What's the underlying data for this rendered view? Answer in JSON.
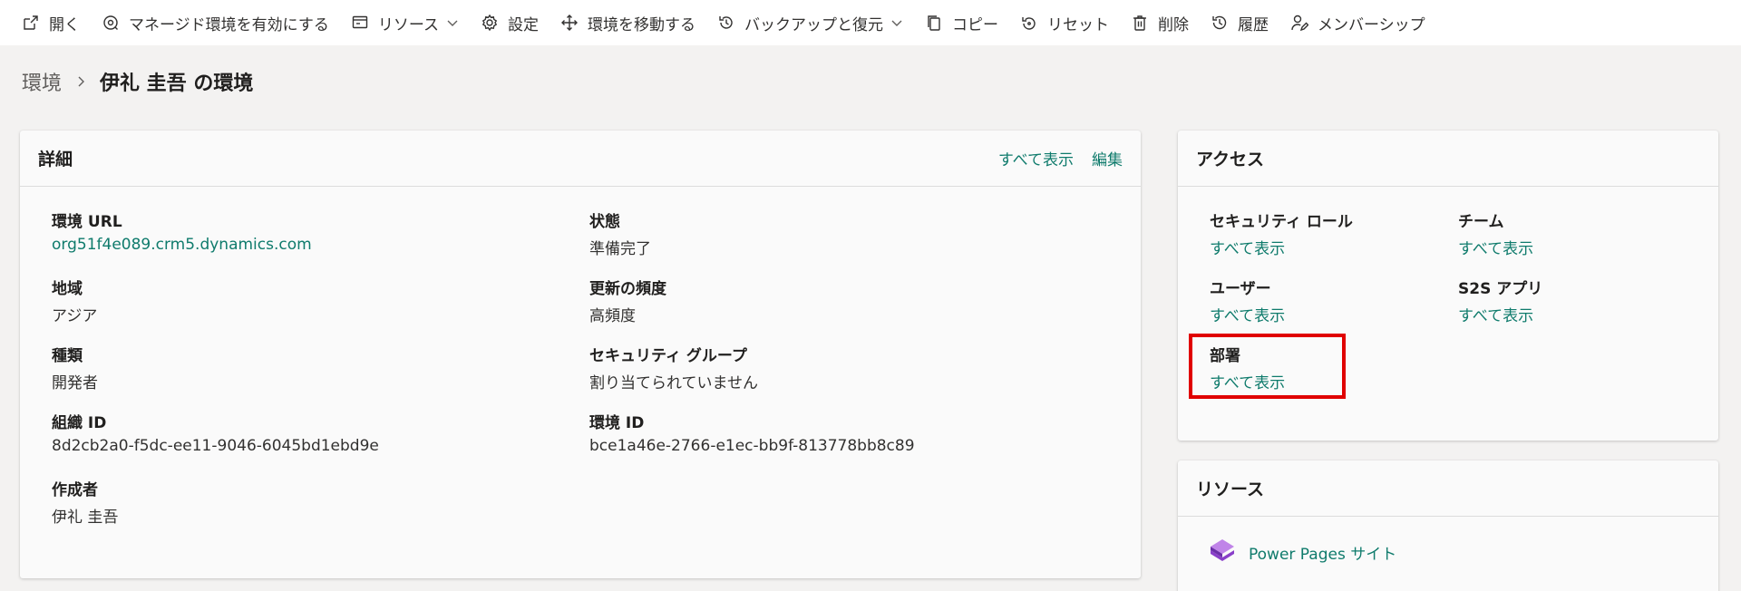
{
  "commandbar": {
    "open": "開く",
    "enable_managed": "マネージド環境を有効にする",
    "resources": "リソース",
    "settings": "設定",
    "move_env": "環境を移動する",
    "backup_restore": "バックアップと復元",
    "copy": "コピー",
    "reset": "リセット",
    "delete": "削除",
    "history": "履歴",
    "membership": "メンバーシップ"
  },
  "breadcrumb": {
    "root": "環境",
    "current": "伊礼 圭吾 の環境"
  },
  "details": {
    "title": "詳細",
    "view_all": "すべて表示",
    "edit": "編集",
    "env_url_label": "環境 URL",
    "env_url_value": "org51f4e089.crm5.dynamics.com",
    "state_label": "状態",
    "state_value": "準備完了",
    "region_label": "地域",
    "region_value": "アジア",
    "update_freq_label": "更新の頻度",
    "update_freq_value": "高頻度",
    "type_label": "種類",
    "type_value": "開発者",
    "security_group_label": "セキュリティ グループ",
    "security_group_value": "割り当てられていません",
    "org_id_label": "組織 ID",
    "org_id_value": "8d2cb2a0-f5dc-ee11-9046-6045bd1ebd9e",
    "env_id_label": "環境 ID",
    "env_id_value": "bce1a46e-2766-e1ec-bb9f-813778bb8c89",
    "creator_label": "作成者",
    "creator_value": "伊礼 圭吾"
  },
  "access": {
    "title": "アクセス",
    "security_roles_label": "セキュリティ ロール",
    "teams_label": "チーム",
    "users_label": "ユーザー",
    "s2s_label": "S2S アプリ",
    "business_units_label": "部署",
    "view_all": "すべて表示"
  },
  "resources": {
    "title": "リソース",
    "power_pages": "Power Pages サイト"
  },
  "colors": {
    "accent": "#0f7b6c",
    "highlight": "#e00000",
    "background": "#f3f2f1"
  }
}
